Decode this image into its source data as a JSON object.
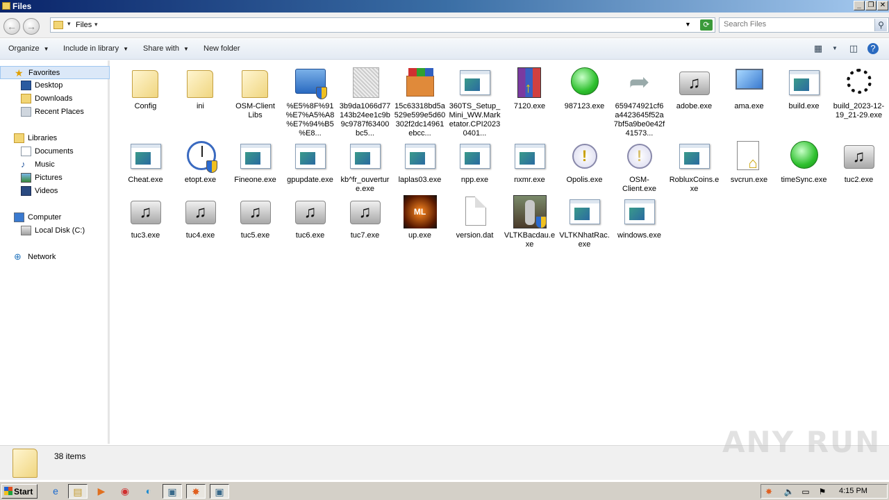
{
  "window": {
    "title": "Files"
  },
  "address": {
    "crumb": "Files"
  },
  "search": {
    "placeholder": "Search Files"
  },
  "toolbar": {
    "organize": "Organize",
    "include_in_library": "Include in library",
    "share_with": "Share with",
    "new_folder": "New folder"
  },
  "sidebar": {
    "favorites": "Favorites",
    "desktop": "Desktop",
    "downloads": "Downloads",
    "recent_places": "Recent Places",
    "libraries": "Libraries",
    "documents": "Documents",
    "music": "Music",
    "pictures": "Pictures",
    "videos": "Videos",
    "computer": "Computer",
    "local_disk": "Local Disk (C:)",
    "network": "Network"
  },
  "files": [
    {
      "name": "Config",
      "icon": "folder-icon"
    },
    {
      "name": "ini",
      "icon": "folder-icon"
    },
    {
      "name": "OSM-Client Libs",
      "icon": "folder-icon"
    },
    {
      "name": "%E5%8F%91%E7%A5%A8%E7%94%B5%E8...",
      "icon": "shield-folder-icon"
    },
    {
      "name": "3b9da1066d77143b24ee1c9b9c9787f63400bc5...",
      "icon": "scrambled-icon"
    },
    {
      "name": "15c63318bd5a529e599e5d60302f2dc14961ebcc...",
      "icon": "package-icon"
    },
    {
      "name": "360TS_Setup_Mini_WW.Marketator.CPI20230401...",
      "icon": "window-exe-icon"
    },
    {
      "name": "7120.exe",
      "icon": "winrar-icon"
    },
    {
      "name": "987123.exe",
      "icon": "green-circle-icon"
    },
    {
      "name": "659474921cf6a4423645f52a7bf5a9be0e42f41573...",
      "icon": "arrow-icon"
    },
    {
      "name": "adobe.exe",
      "icon": "speaker-icon"
    },
    {
      "name": "ama.exe",
      "icon": "computer-icon"
    },
    {
      "name": "build.exe",
      "icon": "window-exe-icon"
    },
    {
      "name": "build_2023-12-19_21-29.exe",
      "icon": "spinner-icon"
    },
    {
      "name": "Cheat.exe",
      "icon": "window-exe-icon"
    },
    {
      "name": "etopt.exe",
      "icon": "clock-icon"
    },
    {
      "name": "Fineone.exe",
      "icon": "window-exe-icon"
    },
    {
      "name": "gpupdate.exe",
      "icon": "window-exe-icon"
    },
    {
      "name": "kb^fr_ouverture.exe",
      "icon": "window-exe-icon"
    },
    {
      "name": "laplas03.exe",
      "icon": "window-exe-icon"
    },
    {
      "name": "npp.exe",
      "icon": "window-exe-icon"
    },
    {
      "name": "nxmr.exe",
      "icon": "window-exe-icon"
    },
    {
      "name": "Opolis.exe",
      "icon": "warning-icon"
    },
    {
      "name": "OSM-Client.exe",
      "icon": "warning-icon"
    },
    {
      "name": "RobluxCoins.exe",
      "icon": "window-exe-icon"
    },
    {
      "name": "svcrun.exe",
      "icon": "svcrun-icon"
    },
    {
      "name": "timeSync.exe",
      "icon": "green-circle-icon"
    },
    {
      "name": "tuc2.exe",
      "icon": "speaker-icon"
    },
    {
      "name": "tuc3.exe",
      "icon": "speaker-icon"
    },
    {
      "name": "tuc4.exe",
      "icon": "speaker-icon"
    },
    {
      "name": "tuc5.exe",
      "icon": "speaker-icon"
    },
    {
      "name": "tuc6.exe",
      "icon": "speaker-icon"
    },
    {
      "name": "tuc7.exe",
      "icon": "speaker-icon"
    },
    {
      "name": "up.exe",
      "icon": "up-exe-icon"
    },
    {
      "name": "version.dat",
      "icon": "document-icon"
    },
    {
      "name": "VLTKBacdau.exe",
      "icon": "game-character-icon"
    },
    {
      "name": "VLTKNhatRac.exe",
      "icon": "window-exe-icon"
    },
    {
      "name": "windows.exe",
      "icon": "window-exe-icon"
    }
  ],
  "status": {
    "count": "38 items"
  },
  "watermark": "ANY RUN",
  "taskbar": {
    "start": "Start",
    "clock": "4:15 PM"
  }
}
